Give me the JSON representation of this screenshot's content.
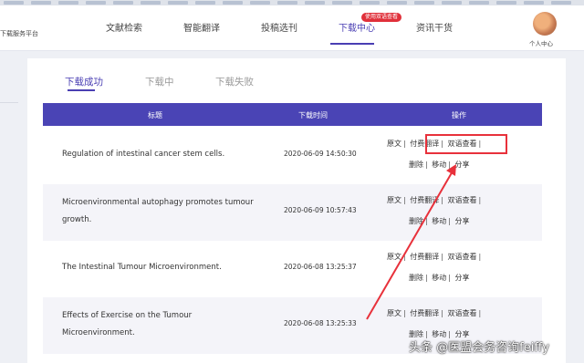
{
  "header": {
    "brand": "下载服务平台",
    "nav": [
      {
        "label": "文献检索"
      },
      {
        "label": "智能翻译"
      },
      {
        "label": "投稿选刊"
      },
      {
        "label": "下载中心"
      },
      {
        "label": "资讯干货"
      }
    ],
    "badge": "使用双语查看",
    "user_label": "个人中心"
  },
  "tabs": [
    "下载成功",
    "下载中",
    "下载失败"
  ],
  "table": {
    "columns": [
      "标题",
      "下载时间",
      "操作"
    ],
    "actions": {
      "original": "原文",
      "paid_translate": "付费翻译",
      "bilingual": "双语查看",
      "delete": "删除",
      "move": "移动",
      "share": "分享"
    },
    "rows": [
      {
        "title": "Regulation of intestinal cancer stem cells.",
        "time": "2020-06-09 14:50:30"
      },
      {
        "title": "Microenvironmental autophagy promotes tumour growth.",
        "time": "2020-06-09 10:57:43"
      },
      {
        "title": "The Intestinal Tumour Microenvironment.",
        "time": "2020-06-08 13:25:37"
      },
      {
        "title": "Effects of Exercise on the Tumour Microenvironment.",
        "time": "2020-06-08 13:25:33"
      }
    ]
  },
  "watermark": "头条 @医盟会务咨询feiffy",
  "colors": {
    "accent": "#4a3fb3",
    "highlight": "#e8313b"
  }
}
